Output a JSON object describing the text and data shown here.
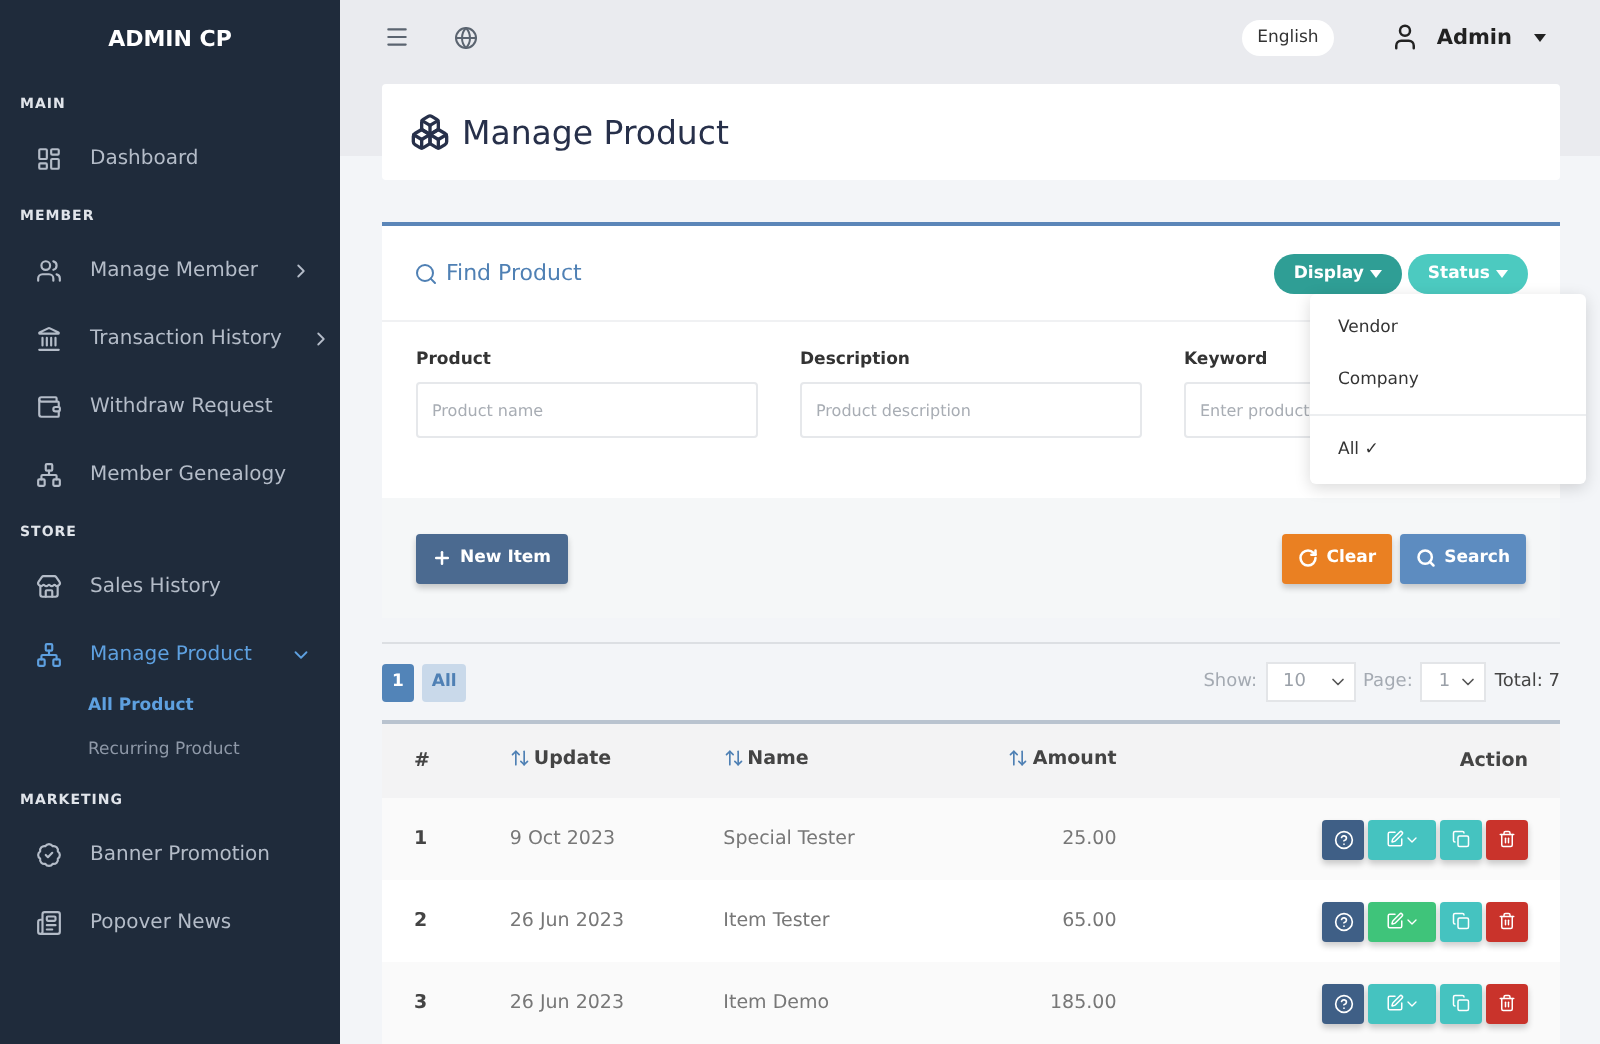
{
  "sidebar": {
    "brand": "ADMIN CP",
    "sections": [
      {
        "title": "MAIN",
        "items": [
          {
            "label": "Dashboard",
            "selected": false
          }
        ]
      },
      {
        "title": "MEMBER",
        "items": [
          {
            "label": "Manage Member",
            "expanded": false,
            "selected": false
          },
          {
            "label": "Transaction History",
            "expanded": false,
            "selected": false
          },
          {
            "label": "Withdraw Request",
            "selected": false
          },
          {
            "label": "Member Genealogy",
            "selected": false
          }
        ]
      },
      {
        "title": "STORE",
        "items": [
          {
            "label": "Sales History",
            "selected": false
          },
          {
            "label": "Manage Product",
            "expanded": true,
            "selected": true,
            "children": [
              {
                "label": "All Product",
                "selected": true
              },
              {
                "label": "Recurring Product",
                "selected": false
              }
            ]
          }
        ]
      },
      {
        "title": "MARKETING",
        "items": [
          {
            "label": "Banner Promotion",
            "selected": false
          },
          {
            "label": "Popover News",
            "selected": false
          }
        ]
      }
    ]
  },
  "topbar": {
    "language": "English",
    "user": "Admin"
  },
  "page_title": "Manage Product",
  "find": {
    "title": "Find Product",
    "buttons": [
      {
        "label": "Display",
        "kind": "dark"
      },
      {
        "label": "Status",
        "kind": "light"
      }
    ],
    "menu": [
      {
        "label": "Vendor",
        "kind": "item"
      },
      {
        "label": "Company",
        "kind": "item"
      },
      {
        "label": "All ✓",
        "kind": "divided"
      }
    ],
    "fields": [
      {
        "label": "Product",
        "placeholder": "Product name"
      },
      {
        "label": "Description",
        "placeholder": "Product description"
      },
      {
        "label": "Keyword",
        "placeholder": "Enter product"
      }
    ],
    "new_button": "New Item",
    "clear_button": "Clear",
    "search_button": "Search"
  },
  "pager": {
    "pages": [
      {
        "label": "1",
        "selected": true
      },
      {
        "label": "All",
        "selected": false
      }
    ],
    "show_label": "Show:",
    "show_value": "10",
    "page_label": "Page:",
    "page_value": "1",
    "total": "Total: 7"
  },
  "table": {
    "columns": [
      {
        "label": "#",
        "sortable": false
      },
      {
        "label": "Update",
        "sortable": true
      },
      {
        "label": "Name",
        "sortable": true
      },
      {
        "label": "Amount",
        "sortable": true
      },
      {
        "label": "Action",
        "sortable": false
      }
    ],
    "rows": [
      {
        "no": "1",
        "update": "9 Oct 2023",
        "name": "Special Tester",
        "amount": "25.00",
        "color": "#45c3c0"
      },
      {
        "no": "2",
        "update": "26 Jun 2023",
        "name": "Item Tester",
        "amount": "65.00",
        "color": "#3fc47a"
      },
      {
        "no": "3",
        "update": "26 Jun 2023",
        "name": "Item Demo",
        "amount": "185.00",
        "color": "#45c3c0"
      }
    ]
  }
}
